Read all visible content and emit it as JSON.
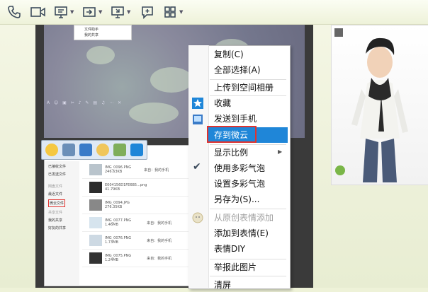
{
  "toolbar": {
    "icons": [
      "phone-icon",
      "video-icon",
      "screen-share-icon",
      "send-file-icon",
      "remote-desktop-icon",
      "add-chat-icon",
      "apps-grid-icon"
    ]
  },
  "screenshot": {
    "menu_items": [
      "文件助手",
      "我的共享"
    ],
    "sidebar_items": [
      "已接收文件",
      "已发送文件",
      "网盘文件",
      "最近文件",
      "微云文件",
      "共享文件",
      "我的共享",
      "好友的共享"
    ],
    "file_rows": [
      {
        "name": "IMG_0096.PNG",
        "size": "246.63KB",
        "src": "来自：我的手机"
      },
      {
        "name": "E004156D1FE6B5...png",
        "size": "41.79KB",
        "src": ""
      },
      {
        "name": "IMG_0094.JPG",
        "size": "276.35KB",
        "src": ""
      },
      {
        "name": "IMG_0077.PNG",
        "size": "1.46MB",
        "src": "来自：我的手机"
      },
      {
        "name": "IMG_0076.PNG",
        "size": "1.73MB",
        "src": "来自：我的手机"
      },
      {
        "name": "IMG_0075.PNG",
        "size": "1.24MB",
        "src": "来自：我的手机"
      }
    ]
  },
  "context_menu": {
    "items": [
      {
        "label": "复制(C)",
        "enabled": true
      },
      {
        "label": "全部选择(A)",
        "enabled": true
      },
      {
        "label": "上传到空间相册",
        "enabled": true
      },
      {
        "label": "收藏",
        "enabled": true
      },
      {
        "label": "发送到手机",
        "enabled": true
      },
      {
        "label": "存到微云",
        "enabled": true,
        "highlighted": true
      },
      {
        "label": "显示比例",
        "enabled": true,
        "submenu": true
      },
      {
        "label": "使用多彩气泡",
        "enabled": true,
        "checked": true
      },
      {
        "label": "设置多彩气泡",
        "enabled": true
      },
      {
        "label": "另存为(S)...",
        "enabled": true
      },
      {
        "label": "从原创表情添加",
        "enabled": false
      },
      {
        "label": "添加到表情(E)",
        "enabled": true
      },
      {
        "label": "表情DIY",
        "enabled": true
      },
      {
        "label": "举报此图片",
        "enabled": true
      },
      {
        "label": "清屏",
        "enabled": true
      }
    ]
  },
  "colors": {
    "highlight": "#1f86d8",
    "annotation": "#e0332f"
  }
}
